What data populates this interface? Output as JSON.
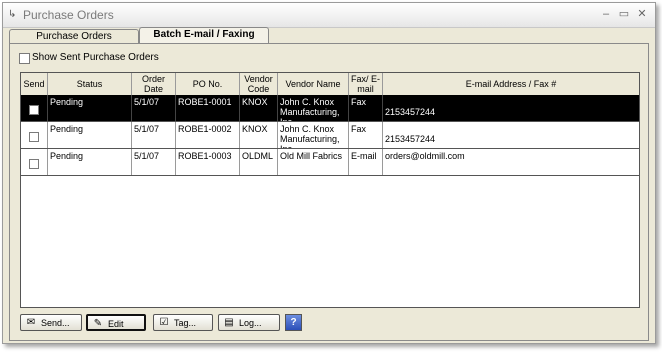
{
  "window": {
    "title": "Purchase Orders",
    "minimize": "–",
    "restore": "▭",
    "close": "✕"
  },
  "tabs": [
    {
      "label": "Purchase Orders"
    },
    {
      "label": "Batch E-mail / Faxing"
    }
  ],
  "filter": {
    "show_sent_label": "Show Sent Purchase Orders",
    "checked": false
  },
  "grid": {
    "columns": [
      "Send",
      "Status",
      "Order Date",
      "PO No.",
      "Vendor Code",
      "Vendor Name",
      "Fax/ E-mail",
      "E-mail Address / Fax #"
    ],
    "rows": [
      {
        "status": "Pending",
        "date": "5/1/07",
        "po": "ROBE1-0001",
        "vendor_code": "KNOX",
        "vendor_name": "John C. Knox Manufacturing, Inc.",
        "method": "Fax",
        "address": "2153457244",
        "selected": true
      },
      {
        "status": "Pending",
        "date": "5/1/07",
        "po": "ROBE1-0002",
        "vendor_code": "KNOX",
        "vendor_name": "John C. Knox Manufacturing, Inc.",
        "method": "Fax",
        "address": "2153457244",
        "selected": false
      },
      {
        "status": "Pending",
        "date": "5/1/07",
        "po": "ROBE1-0003",
        "vendor_code": "OLDML",
        "vendor_name": "Old Mill Fabrics",
        "method": "E-mail",
        "address": "orders@oldmill.com",
        "selected": false
      }
    ]
  },
  "buttons": {
    "send": "Send...",
    "edit": "Edit",
    "tag": "Tag...",
    "log": "Log...",
    "help": "?"
  },
  "icons": {
    "app": "app-icon",
    "send": "send-icon",
    "edit": "pencil-icon",
    "tag": "tag-icon",
    "log": "log-icon",
    "help": "help-icon"
  }
}
